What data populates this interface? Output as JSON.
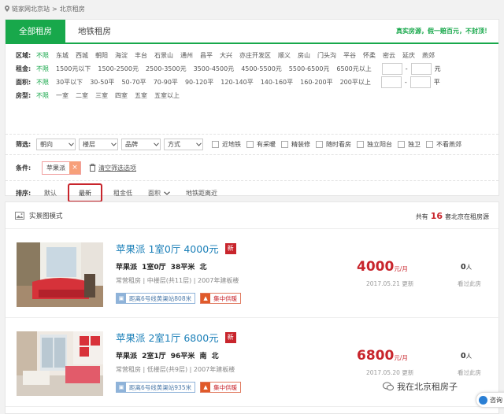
{
  "breadcrumb": {
    "site": "链家网北京站",
    "sep": ">",
    "current": "北京租房"
  },
  "tabs": [
    {
      "label": "全部租房"
    },
    {
      "label": "地铁租房"
    }
  ],
  "slogan": "真实房源，假一赔百元，不封顶！",
  "filters": {
    "region": {
      "label": "区域:",
      "options": [
        "不限",
        "东城",
        "西城",
        "朝阳",
        "海淀",
        "丰台",
        "石景山",
        "通州",
        "昌平",
        "大兴",
        "亦庄开发区",
        "顺义",
        "房山",
        "门头沟",
        "平谷",
        "怀柔",
        "密云",
        "延庆",
        "燕郊"
      ]
    },
    "rent": {
      "label": "租金:",
      "options": [
        "不限",
        "1500元以下",
        "1500-2500元",
        "2500-3500元",
        "3500-4500元",
        "4500-5500元",
        "5500-6500元",
        "6500元以上"
      ],
      "range_sep": "-",
      "unit": "元"
    },
    "area": {
      "label": "面积:",
      "options": [
        "不限",
        "30平以下",
        "30-50平",
        "50-70平",
        "70-90平",
        "90-120平",
        "120-140平",
        "140-160平",
        "160-200平",
        "200平以上"
      ],
      "range_sep": "-",
      "unit": "平"
    },
    "layout": {
      "label": "房型:",
      "options": [
        "不限",
        "一室",
        "二室",
        "三室",
        "四室",
        "五室",
        "五室以上"
      ]
    }
  },
  "screen": {
    "label": "筛选:",
    "dropdowns": [
      "朝向",
      "楼层",
      "品牌",
      "方式"
    ],
    "checkboxes": [
      "近地铁",
      "有采暖",
      "精装修",
      "随时看房",
      "独立阳台",
      "独卫",
      "不看燕郊"
    ]
  },
  "conditions": {
    "label": "条件:",
    "chip": "苹果派",
    "chip_close": "×",
    "clear": "清空筛选选项"
  },
  "sort": {
    "label": "排序:",
    "options": [
      "默认",
      "最新",
      "租金低",
      "面积",
      "地铁距离近"
    ],
    "active": "最新"
  },
  "list_header": {
    "mode": "实景图模式",
    "prefix": "共有",
    "count": "16",
    "suffix": "套北京在租房源"
  },
  "listings": [
    {
      "title": "苹果派  1室0厅  4000元",
      "new": "新",
      "spec": "苹果派  1室0厅  38平米  北",
      "meta": "常营租房 | 中楼层(共11层) | 2007年建板楼",
      "subway": "距离6号线黄渠站808米",
      "heating": "集中供暖",
      "price": "4000",
      "price_unit": "元/月",
      "date": "2017.05.21 更新",
      "views": "0",
      "views_unit": "人",
      "views_label": "看过此房"
    },
    {
      "title": "苹果派  2室1厅  6800元",
      "new": "新",
      "spec": "苹果派  2室1厅  96平米  南 北",
      "meta": "常营租房 | 低楼层(共9层) | 2007年建板楼",
      "subway": "距离6号线黄渠站935米",
      "heating": "集中供暖",
      "price": "6800",
      "price_unit": "元/月",
      "date": "2017.05.20 更新",
      "views": "0",
      "views_unit": "人",
      "views_label": "看过此房"
    }
  ],
  "watermark": "我在北京租房子",
  "consult": "咨询",
  "colors": {
    "green": "#18a84b",
    "red": "#c8252c",
    "link": "#1a7fb8"
  }
}
